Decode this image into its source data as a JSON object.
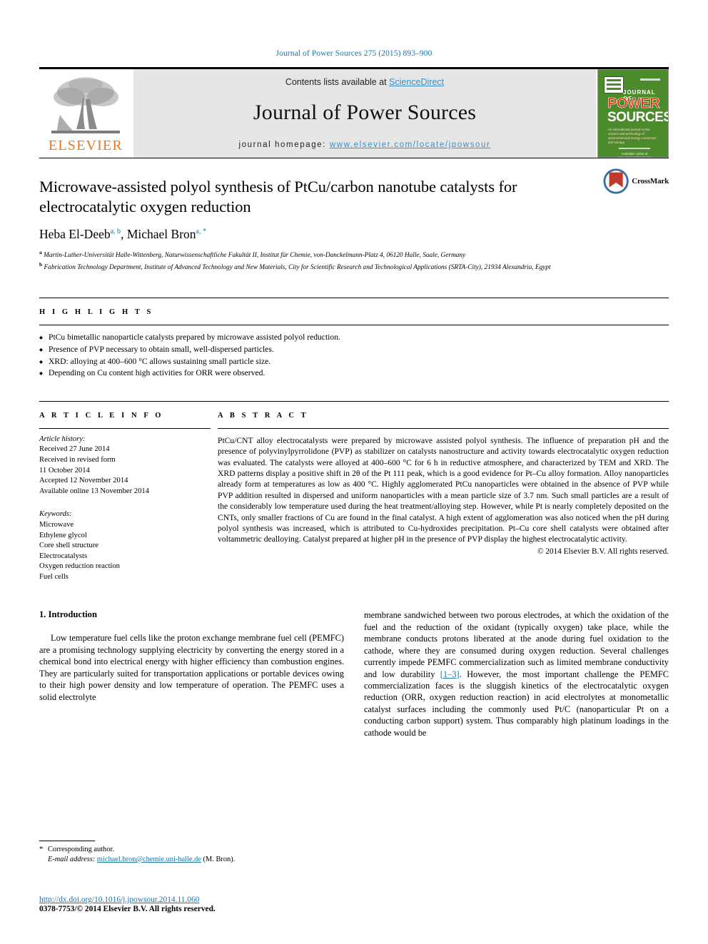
{
  "running_head": "Journal of Power Sources 275 (2015) 893–900",
  "masthead": {
    "contents_prefix": "Contents lists available at ",
    "sciencedirect": "ScienceDirect",
    "journal_name": "Journal of Power Sources",
    "homepage_prefix": "journal homepage: ",
    "homepage_url": "www.elsevier.com/locate/jpowsour",
    "publisher": "ELSEVIER",
    "cover": {
      "journal_of": "JOURNAL OF",
      "power": "POWER",
      "sources": "SOURCES",
      "tagline": "An international journal on the science and technology of electrochemical energy conversion and storage",
      "footer": "Available online at www.sciencedirect.com"
    },
    "accent_blue": "#3d8fc6",
    "elsevier_orange": "#e77817",
    "cover_green": "#4c8b2b"
  },
  "article": {
    "title": "Microwave-assisted polyol synthesis of PtCu/carbon nanotube catalysts for electrocatalytic oxygen reduction",
    "authors_plain": "Heba El-Deeb a, b, Michael Bron a, *",
    "author_1_name": "Heba El-Deeb",
    "author_1_marks": "a, b",
    "author_2_name": "Michael Bron",
    "author_2_marks": "a, *",
    "affiliation_a_mark": "a",
    "affiliation_a": "Martin-Luther-Universität Halle-Wittenberg, Naturwissenschaftliche Fakultät II, Institut für Chemie, von-Danckelmann-Platz 4, 06120 Halle, Saale, Germany",
    "affiliation_b_mark": "b",
    "affiliation_b": "Fabrication Technology Department, Institute of Advanced Technology and New Materials, City for Scientific Research and Technological Applications (SRTA-City), 21934 Alexandria, Egypt",
    "crossmark_label": "CrossMark"
  },
  "highlights": {
    "heading": "H I G H L I G H T S",
    "items": [
      "PtCu bimetallic nanoparticle catalysts prepared by microwave assisted polyol reduction.",
      "Presence of PVP necessary to obtain small, well-dispersed particles.",
      "XRD: alloying at 400–600 °C allows sustaining small particle size.",
      "Depending on Cu content high activities for ORR were observed."
    ]
  },
  "article_info": {
    "heading": "A R T I C L E  I N F O",
    "history_label": "Article history:",
    "history": [
      "Received 27 June 2014",
      "Received in revised form",
      "11 October 2014",
      "Accepted 12 November 2014",
      "Available online 13 November 2014"
    ],
    "keywords_label": "Keywords:",
    "keywords": [
      "Microwave",
      "Ethylene glycol",
      "Core shell structure",
      "Electrocatalysts",
      "Oxygen reduction reaction",
      "Fuel cells"
    ]
  },
  "abstract": {
    "heading": "A B S T R A C T",
    "text": "PtCu/CNT alloy electrocatalysts were prepared by microwave assisted polyol synthesis. The influence of preparation pH and the presence of polyvinylpyrrolidone (PVP) as stabilizer on catalysts nanostructure and activity towards electrocatalytic oxygen reduction was evaluated. The catalysts were alloyed at 400–600 °C for 6 h in reductive atmosphere, and characterized by TEM and XRD. The XRD patterns display a positive shift in 2θ of the Pt 111 peak, which is a good evidence for Pt–Cu alloy formation. Alloy nanoparticles already form at temperatures as low as 400 °C. Highly agglomerated PtCu nanoparticles were obtained in the absence of PVP while PVP addition resulted in dispersed and uniform nanoparticles with a mean particle size of 3.7 nm. Such small particles are a result of the considerably low temperature used during the heat treatment/alloying step. However, while Pt is nearly completely deposited on the CNTs, only smaller fractions of Cu are found in the final catalyst. A high extent of agglomeration was also noticed when the pH during polyol synthesis was increased, which is attributed to Cu-hydroxides precipitation. Pt–Cu core shell catalysts were obtained after voltammetric dealloying. Catalyst prepared at higher pH in the presence of PVP display the highest electrocatalytic activity.",
    "copyright": "© 2014 Elsevier B.V. All rights reserved."
  },
  "introduction": {
    "heading": "1.  Introduction",
    "left_paragraph": "Low temperature fuel cells like the proton exchange membrane fuel cell (PEMFC) are a promising technology supplying electricity by converting the energy stored in a chemical bond into electrical energy with higher efficiency than combustion engines. They are particularly suited for transportation applications or portable devices owing to their high power density and low temperature of operation. The PEMFC uses a solid electrolyte",
    "right_part_1": "membrane sandwiched between two porous electrodes, at which the oxidation of the fuel and the reduction of the oxidant (typically oxygen) take place, while the membrane conducts protons liberated at the anode during fuel oxidation to the cathode, where they are consumed during oxygen reduction. Several challenges currently impede PEMFC commercialization such as limited membrane conductivity and low durability ",
    "right_reference": "[1–3]",
    "right_part_2": ". However, the most important challenge the PEMFC commercialization faces is the sluggish kinetics of the electrocatalytic oxygen reduction (ORR, oxygen reduction reaction) in acid electrolytes at monometallic catalyst surfaces including the commonly used Pt/C (nanoparticular Pt on a conducting carbon support) system. Thus comparably high platinum loadings in the cathode would be"
  },
  "footer": {
    "corresponding_star": "*",
    "corresponding_author": "Corresponding author.",
    "email_label": "E-mail address:",
    "email": "michael.bron@chemie.uni-halle.de",
    "email_suffix": "(M. Bron).",
    "doi": "http://dx.doi.org/10.1016/j.jpowsour.2014.11.060",
    "issn_line": "0378-7753/© 2014 Elsevier B.V. All rights reserved."
  }
}
